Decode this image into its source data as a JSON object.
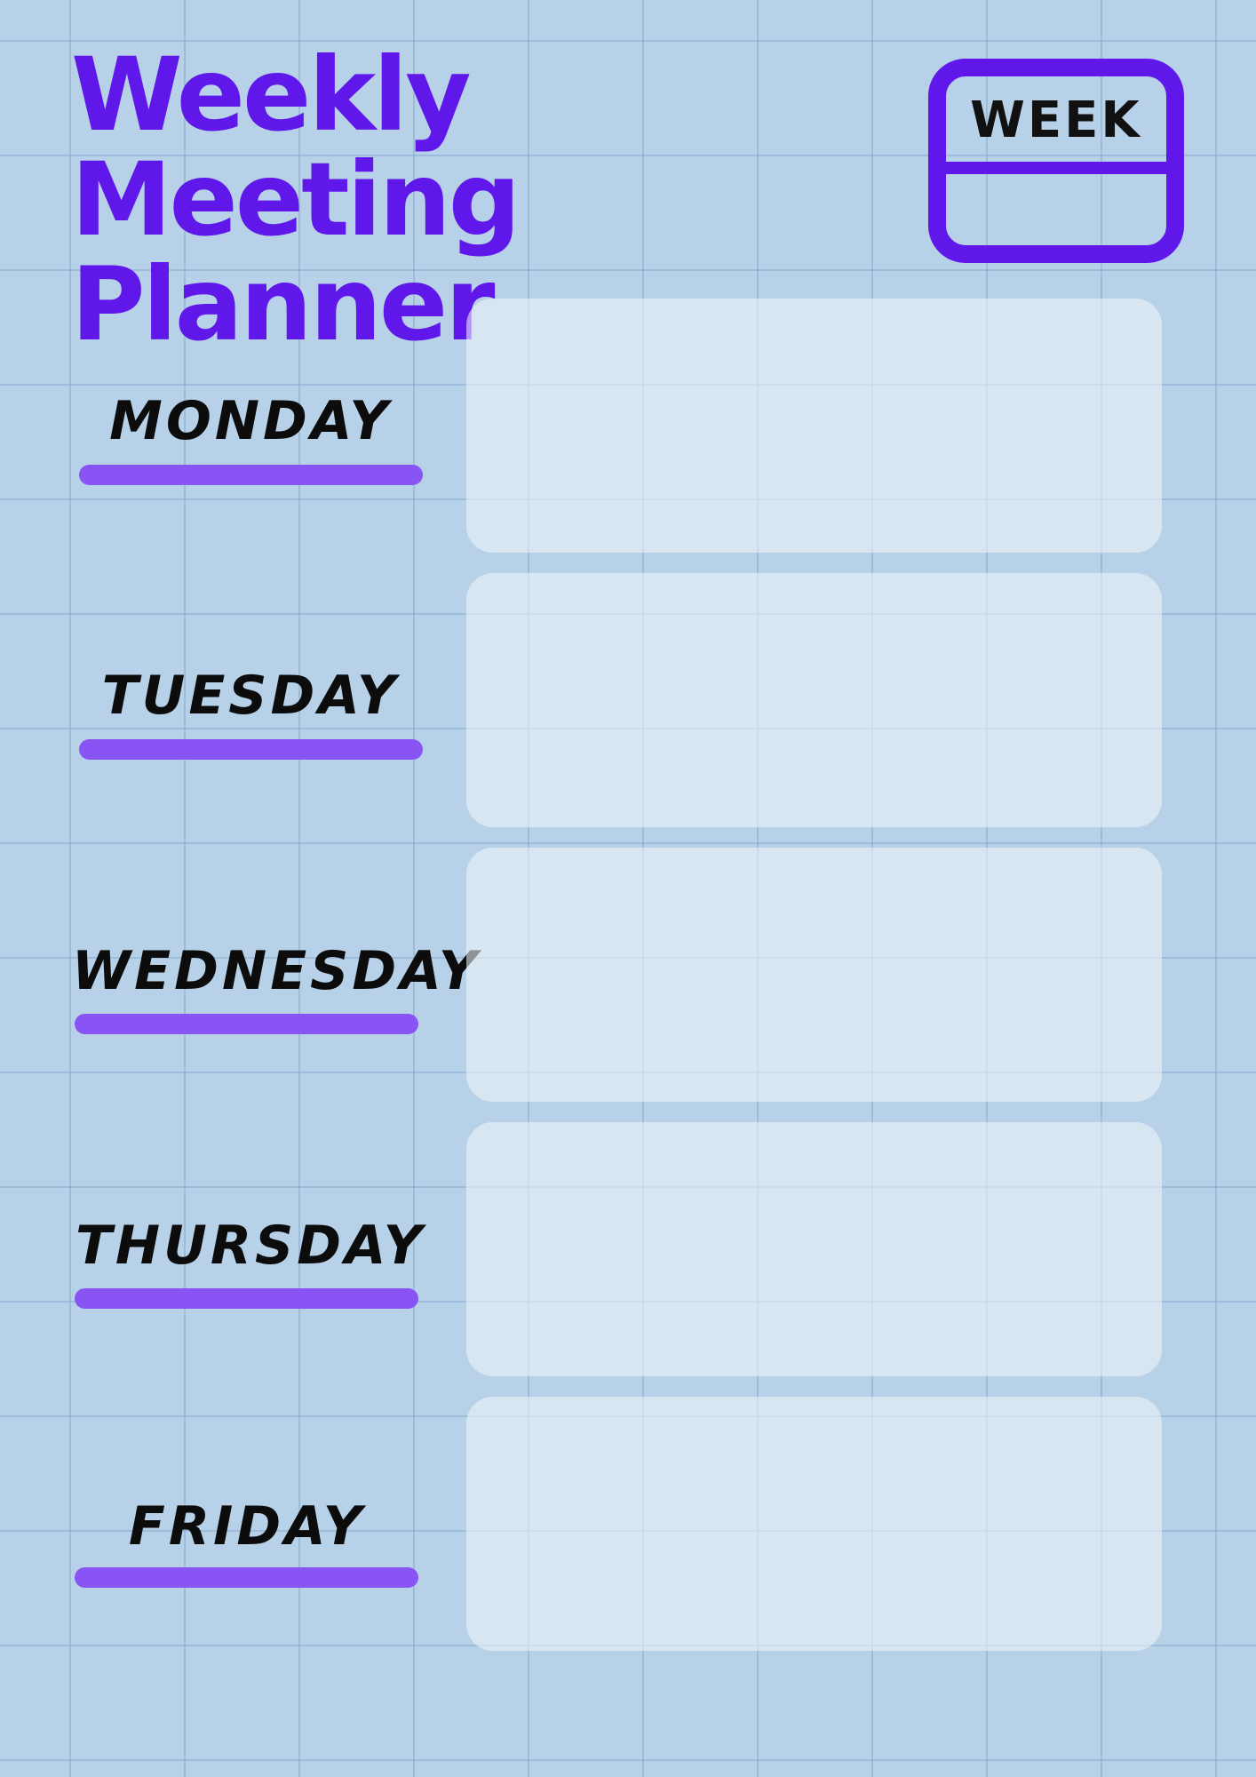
{
  "header": {
    "title": "Weekly Meeting\nPlanner",
    "week_label": "WEEK",
    "week_value": ""
  },
  "days": [
    {
      "label": "MONDAY",
      "notes": ""
    },
    {
      "label": "TUESDAY",
      "notes": ""
    },
    {
      "label": "WEDNESDAY",
      "notes": ""
    },
    {
      "label": "THURSDAY",
      "notes": ""
    },
    {
      "label": "FRIDAY",
      "notes": ""
    }
  ],
  "colors": {
    "background": "#b7d1e8",
    "accent_title": "#6018ea",
    "accent_underline": "#8854f3",
    "day_text": "#0c0c0c",
    "note_box": "#e3ecf5"
  }
}
